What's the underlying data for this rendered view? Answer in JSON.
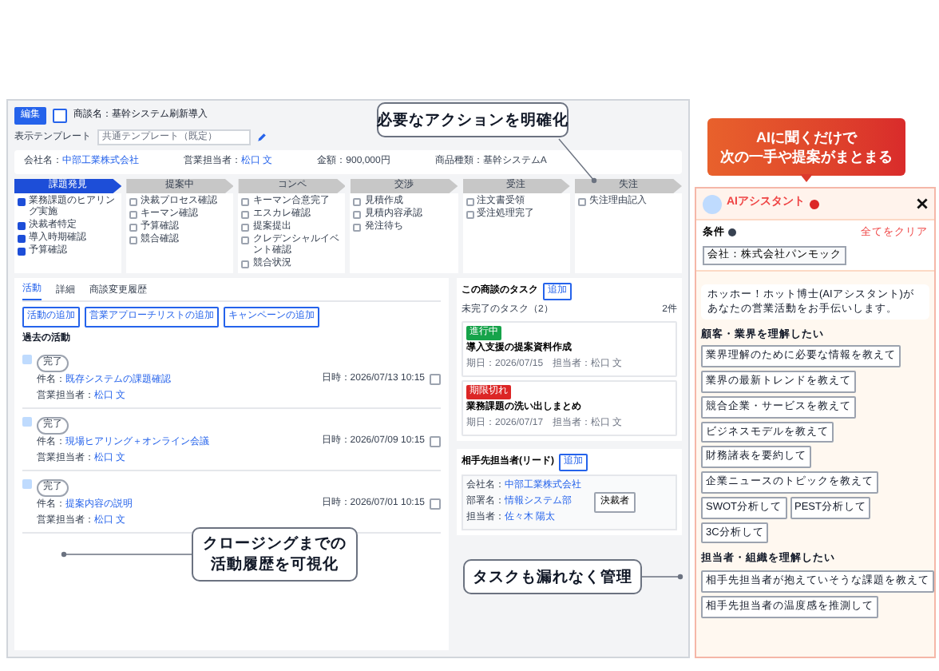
{
  "deal": {
    "edit_button": "編集",
    "title": "商談名：基幹システム刷新導入",
    "template_label": "表示テンプレート",
    "template_value": "共通テンプレート（既定）"
  },
  "info": [
    {
      "label": "会社名：",
      "value": "中部工業株式会社",
      "link": true
    },
    {
      "label": "営業担当者：",
      "value": "松口 文",
      "link": true
    },
    {
      "label": "金額：",
      "value": "900,000円",
      "link": false
    },
    {
      "label": "商品種類：",
      "value": "基幹システムA",
      "link": false
    }
  ],
  "stages": [
    {
      "label": "課題発見",
      "selected": true,
      "items": [
        {
          "text": "業務課題のヒアリング実施",
          "checked": true
        },
        {
          "text": "決裁者特定",
          "checked": true
        },
        {
          "text": "導入時期確認",
          "checked": true
        },
        {
          "text": "予算確認",
          "checked": true
        }
      ]
    },
    {
      "label": "提案中",
      "selected": false,
      "items": [
        {
          "text": "決裁プロセス確認",
          "checked": false
        },
        {
          "text": "キーマン確認",
          "checked": false
        },
        {
          "text": "予算確認",
          "checked": false
        },
        {
          "text": "競合確認",
          "checked": false
        }
      ]
    },
    {
      "label": "コンペ",
      "selected": false,
      "items": [
        {
          "text": "キーマン合意完了",
          "checked": false
        },
        {
          "text": "エスカレ確認",
          "checked": false
        },
        {
          "text": "提案提出",
          "checked": false
        },
        {
          "text": "クレデンシャルイベント確認",
          "checked": false
        },
        {
          "text": "競合状況",
          "checked": false
        }
      ]
    },
    {
      "label": "交渉",
      "selected": false,
      "items": [
        {
          "text": "見積作成",
          "checked": false
        },
        {
          "text": "見積内容承認",
          "checked": false
        },
        {
          "text": "発注待ち",
          "checked": false
        }
      ]
    },
    {
      "label": "受注",
      "selected": false,
      "items": [
        {
          "text": "注文書受領",
          "checked": false
        },
        {
          "text": "受注処理完了",
          "checked": false
        }
      ]
    },
    {
      "label": "失注",
      "selected": false,
      "items": [
        {
          "text": "失注理由記入",
          "checked": false
        }
      ]
    }
  ],
  "activity": {
    "tabs": [
      {
        "label": "活動",
        "selected": true
      },
      {
        "label": "詳細",
        "selected": false
      },
      {
        "label": "商談変更履歴",
        "selected": false
      }
    ],
    "buttons": [
      "活動の追加",
      "営業アプローチリストの追加",
      "キャンペーンの追加"
    ],
    "section": "過去の活動",
    "items": [
      {
        "status": "完了",
        "subject_label": "件名：",
        "subject": "既存システムの課題確認",
        "owner_label": "営業担当者：",
        "owner": "松口 文",
        "date": "日時：2026/07/13 10:15"
      },
      {
        "status": "完了",
        "subject_label": "件名：",
        "subject": "現場ヒアリング＋オンライン会議",
        "owner_label": "営業担当者：",
        "owner": "松口 文",
        "date": "日時：2026/07/09 10:15"
      },
      {
        "status": "完了",
        "subject_label": "件名：",
        "subject": "提案内容の説明",
        "owner_label": "営業担当者：",
        "owner": "松口 文",
        "date": "日時：2026/07/01 10:15"
      }
    ]
  },
  "tasks": {
    "title": "この商談のタスク",
    "add": "追加",
    "group": "未完了のタスク（2）",
    "count": "2件",
    "items": [
      {
        "badge": "進行中",
        "color": "#16a34a",
        "title": "導入支援の提案資料作成",
        "meta": "期日：2026/07/15　担当者：松口 文"
      },
      {
        "badge": "期限切れ",
        "color": "#dc2626",
        "title": "業務課題の洗い出しまとめ",
        "meta": "期日：2026/07/17　担当者：松口 文"
      }
    ]
  },
  "leads": {
    "title": "相手先担当者(リード)",
    "add": "追加",
    "fields": [
      {
        "label": "会社名：",
        "value": "中部工業株式会社"
      },
      {
        "label": "部署名：",
        "value": "情報システム部"
      },
      {
        "label": "担当者：",
        "value": "佐々木 陽太"
      }
    ],
    "role": "決裁者"
  },
  "callouts": [
    {
      "lines": [
        "必要なアクションを明確化"
      ]
    },
    {
      "lines": [
        "タスクも漏れなく管理"
      ]
    },
    {
      "lines": [
        "クロージングまでの",
        "活動履歴を可視化"
      ]
    }
  ],
  "banner": [
    "AIに聞くだけで",
    "次の一手や提案がまとまる"
  ],
  "assistant": {
    "title": "AIアシスタント",
    "condition_label": "条件",
    "clear": "全てをクリア",
    "condition": "会社：株式会社パンモック",
    "message": "ホッホー！ホット博士(AIアシスタント)があなたの営業活動をお手伝いします。",
    "groups": [
      {
        "heading": "顧客・業界を理解したい",
        "chips": [
          "業界理解のために必要な情報を教えて",
          "業界の最新トレンドを教えて",
          "競合企業・サービスを教えて",
          "ビジネスモデルを教えて",
          "財務諸表を要約して",
          "企業ニュースのトピックを教えて",
          "SWOT分析して",
          "PEST分析して",
          "3C分析して"
        ]
      },
      {
        "heading": "担当者・組織を理解したい",
        "chips": [
          "相手先担当者が抱えていそうな課題を教えて",
          "相手先担当者の温度感を推測して"
        ]
      }
    ]
  }
}
